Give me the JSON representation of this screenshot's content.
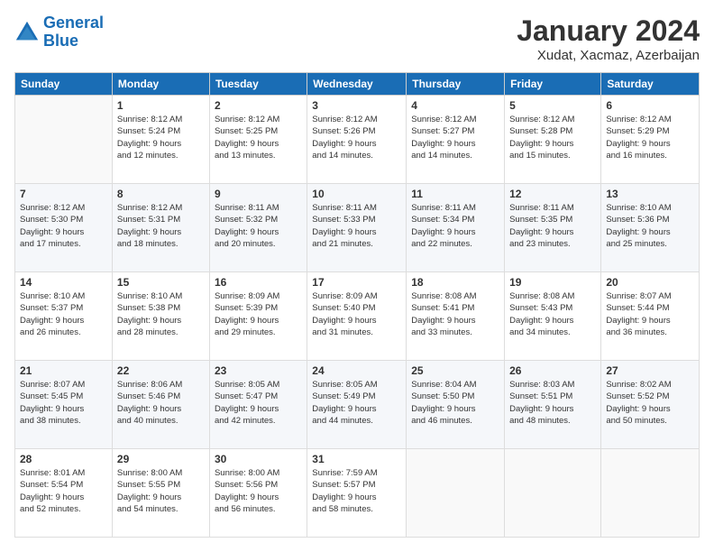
{
  "logo": {
    "line1": "General",
    "line2": "Blue"
  },
  "title": "January 2024",
  "subtitle": "Xudat, Xacmaz, Azerbaijan",
  "weekdays": [
    "Sunday",
    "Monday",
    "Tuesday",
    "Wednesday",
    "Thursday",
    "Friday",
    "Saturday"
  ],
  "weeks": [
    [
      {
        "day": "",
        "info": ""
      },
      {
        "day": "1",
        "info": "Sunrise: 8:12 AM\nSunset: 5:24 PM\nDaylight: 9 hours\nand 12 minutes."
      },
      {
        "day": "2",
        "info": "Sunrise: 8:12 AM\nSunset: 5:25 PM\nDaylight: 9 hours\nand 13 minutes."
      },
      {
        "day": "3",
        "info": "Sunrise: 8:12 AM\nSunset: 5:26 PM\nDaylight: 9 hours\nand 14 minutes."
      },
      {
        "day": "4",
        "info": "Sunrise: 8:12 AM\nSunset: 5:27 PM\nDaylight: 9 hours\nand 14 minutes."
      },
      {
        "day": "5",
        "info": "Sunrise: 8:12 AM\nSunset: 5:28 PM\nDaylight: 9 hours\nand 15 minutes."
      },
      {
        "day": "6",
        "info": "Sunrise: 8:12 AM\nSunset: 5:29 PM\nDaylight: 9 hours\nand 16 minutes."
      }
    ],
    [
      {
        "day": "7",
        "info": "Sunrise: 8:12 AM\nSunset: 5:30 PM\nDaylight: 9 hours\nand 17 minutes."
      },
      {
        "day": "8",
        "info": "Sunrise: 8:12 AM\nSunset: 5:31 PM\nDaylight: 9 hours\nand 18 minutes."
      },
      {
        "day": "9",
        "info": "Sunrise: 8:11 AM\nSunset: 5:32 PM\nDaylight: 9 hours\nand 20 minutes."
      },
      {
        "day": "10",
        "info": "Sunrise: 8:11 AM\nSunset: 5:33 PM\nDaylight: 9 hours\nand 21 minutes."
      },
      {
        "day": "11",
        "info": "Sunrise: 8:11 AM\nSunset: 5:34 PM\nDaylight: 9 hours\nand 22 minutes."
      },
      {
        "day": "12",
        "info": "Sunrise: 8:11 AM\nSunset: 5:35 PM\nDaylight: 9 hours\nand 23 minutes."
      },
      {
        "day": "13",
        "info": "Sunrise: 8:10 AM\nSunset: 5:36 PM\nDaylight: 9 hours\nand 25 minutes."
      }
    ],
    [
      {
        "day": "14",
        "info": "Sunrise: 8:10 AM\nSunset: 5:37 PM\nDaylight: 9 hours\nand 26 minutes."
      },
      {
        "day": "15",
        "info": "Sunrise: 8:10 AM\nSunset: 5:38 PM\nDaylight: 9 hours\nand 28 minutes."
      },
      {
        "day": "16",
        "info": "Sunrise: 8:09 AM\nSunset: 5:39 PM\nDaylight: 9 hours\nand 29 minutes."
      },
      {
        "day": "17",
        "info": "Sunrise: 8:09 AM\nSunset: 5:40 PM\nDaylight: 9 hours\nand 31 minutes."
      },
      {
        "day": "18",
        "info": "Sunrise: 8:08 AM\nSunset: 5:41 PM\nDaylight: 9 hours\nand 33 minutes."
      },
      {
        "day": "19",
        "info": "Sunrise: 8:08 AM\nSunset: 5:43 PM\nDaylight: 9 hours\nand 34 minutes."
      },
      {
        "day": "20",
        "info": "Sunrise: 8:07 AM\nSunset: 5:44 PM\nDaylight: 9 hours\nand 36 minutes."
      }
    ],
    [
      {
        "day": "21",
        "info": "Sunrise: 8:07 AM\nSunset: 5:45 PM\nDaylight: 9 hours\nand 38 minutes."
      },
      {
        "day": "22",
        "info": "Sunrise: 8:06 AM\nSunset: 5:46 PM\nDaylight: 9 hours\nand 40 minutes."
      },
      {
        "day": "23",
        "info": "Sunrise: 8:05 AM\nSunset: 5:47 PM\nDaylight: 9 hours\nand 42 minutes."
      },
      {
        "day": "24",
        "info": "Sunrise: 8:05 AM\nSunset: 5:49 PM\nDaylight: 9 hours\nand 44 minutes."
      },
      {
        "day": "25",
        "info": "Sunrise: 8:04 AM\nSunset: 5:50 PM\nDaylight: 9 hours\nand 46 minutes."
      },
      {
        "day": "26",
        "info": "Sunrise: 8:03 AM\nSunset: 5:51 PM\nDaylight: 9 hours\nand 48 minutes."
      },
      {
        "day": "27",
        "info": "Sunrise: 8:02 AM\nSunset: 5:52 PM\nDaylight: 9 hours\nand 50 minutes."
      }
    ],
    [
      {
        "day": "28",
        "info": "Sunrise: 8:01 AM\nSunset: 5:54 PM\nDaylight: 9 hours\nand 52 minutes."
      },
      {
        "day": "29",
        "info": "Sunrise: 8:00 AM\nSunset: 5:55 PM\nDaylight: 9 hours\nand 54 minutes."
      },
      {
        "day": "30",
        "info": "Sunrise: 8:00 AM\nSunset: 5:56 PM\nDaylight: 9 hours\nand 56 minutes."
      },
      {
        "day": "31",
        "info": "Sunrise: 7:59 AM\nSunset: 5:57 PM\nDaylight: 9 hours\nand 58 minutes."
      },
      {
        "day": "",
        "info": ""
      },
      {
        "day": "",
        "info": ""
      },
      {
        "day": "",
        "info": ""
      }
    ]
  ]
}
